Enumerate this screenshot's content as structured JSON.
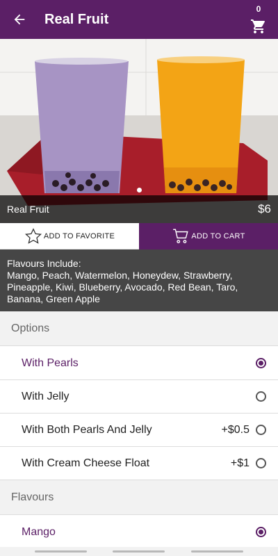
{
  "appbar": {
    "title": "Real Fruit",
    "back_icon": "arrow-back-icon",
    "cart_icon": "shopping-cart-icon",
    "cart_count": "0"
  },
  "hero": {
    "product_name": "Real Fruit",
    "price": "$6"
  },
  "actions": {
    "favorite_label": "ADD TO FAVORITE",
    "favorite_icon": "star-outline-icon",
    "cart_label": "ADD TO CART",
    "cart_icon": "cart-outline-icon"
  },
  "flavour_info": {
    "heading": "Flavours Include:",
    "text": "Mango, Peach, Watermelon, Honeydew, Strawberry, Pineapple, Kiwi, Blueberry, Avocado, Red Bean, Taro, Banana, Green Apple"
  },
  "options": {
    "header": "Options",
    "items": [
      {
        "label": "With Pearls",
        "price": "",
        "selected": true
      },
      {
        "label": "With Jelly",
        "price": "",
        "selected": false
      },
      {
        "label": "With Both Pearls And Jelly",
        "price": "+$0.5",
        "selected": false
      },
      {
        "label": "With Cream Cheese Float",
        "price": "+$1",
        "selected": false
      }
    ]
  },
  "flavours": {
    "header": "Flavours",
    "items": [
      {
        "label": "Mango",
        "selected": true
      }
    ]
  },
  "colors": {
    "brand": "#5b1f66",
    "caption_bg": "#464646"
  }
}
